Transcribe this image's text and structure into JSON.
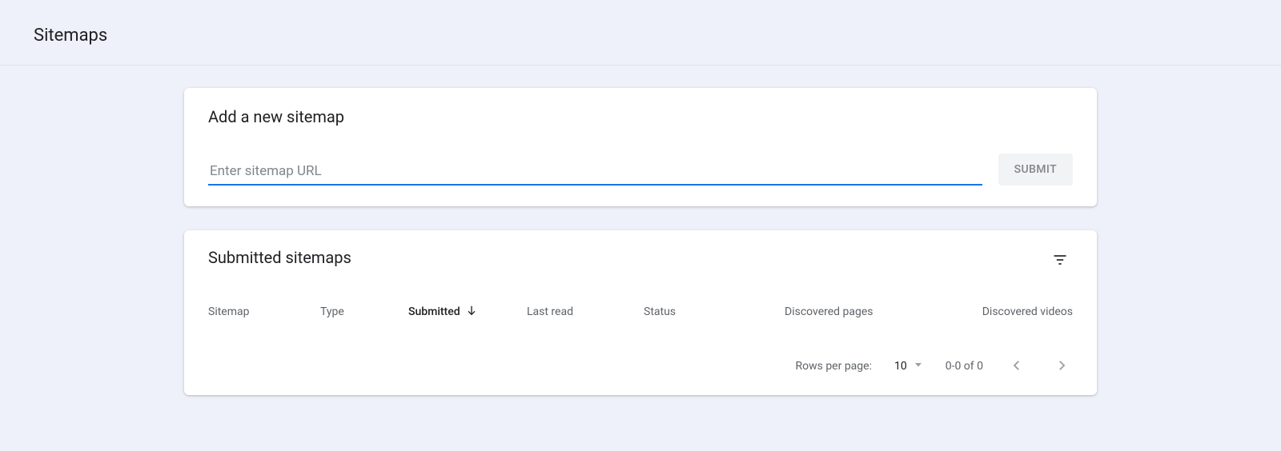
{
  "page": {
    "title": "Sitemaps"
  },
  "add": {
    "title": "Add a new sitemap",
    "placeholder": "Enter sitemap URL",
    "submit": "SUBMIT"
  },
  "list": {
    "title": "Submitted sitemaps",
    "columns": {
      "sitemap": "Sitemap",
      "type": "Type",
      "submitted": "Submitted",
      "lastread": "Last read",
      "status": "Status",
      "pages": "Discovered pages",
      "videos": "Discovered videos"
    },
    "pager": {
      "rows_label": "Rows per page:",
      "rows_value": "10",
      "range": "0-0 of 0"
    }
  }
}
